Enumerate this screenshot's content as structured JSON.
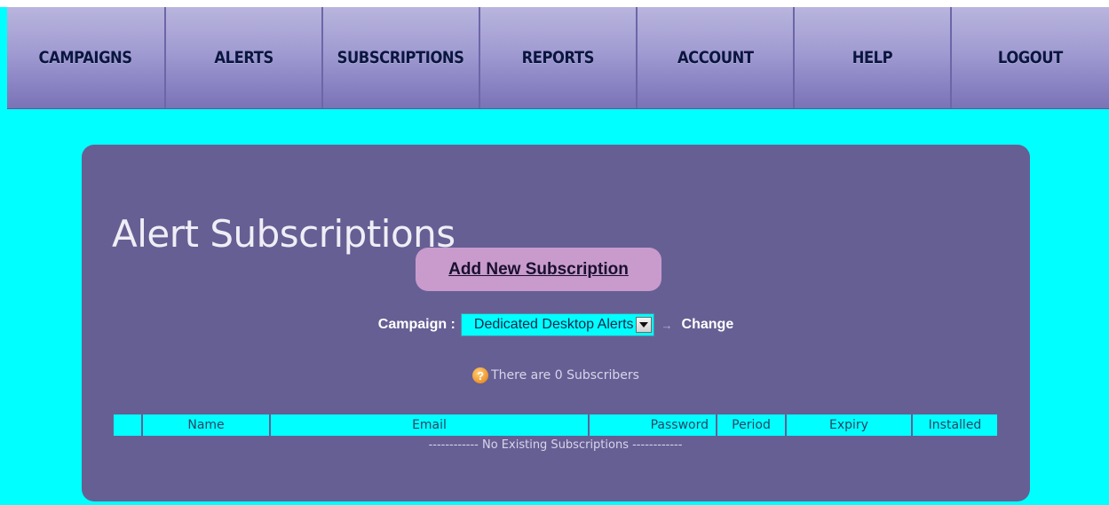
{
  "nav": {
    "items": [
      {
        "label": "CAMPAIGNS"
      },
      {
        "label": "ALERTS"
      },
      {
        "label": "SUBSCRIPTIONS"
      },
      {
        "label": "REPORTS"
      },
      {
        "label": "ACCOUNT"
      },
      {
        "label": "HELP"
      },
      {
        "label": "LOGOUT"
      }
    ]
  },
  "main": {
    "title": "Alert Subscriptions",
    "add_button_label": "Add New Subscription",
    "campaign": {
      "label": "Campaign :",
      "selected_value": "Dedicated Desktop Alerts",
      "arrow": "→",
      "change_label": "Change"
    },
    "info": {
      "icon": "question-icon",
      "icon_glyph": "?",
      "text": "There are 0 Subscribers"
    },
    "table": {
      "columns": [
        "",
        "Name",
        "Email",
        "Password",
        "Period",
        "Expiry",
        "Installed"
      ],
      "empty_message": "------------ No Existing Subscriptions ------------"
    }
  },
  "colors": {
    "page_background": "#00ffff",
    "panel_background": "#665f94",
    "nav_text": "#0a1640",
    "add_button_background": "#c89bcc",
    "table_header_background": "#00ffff"
  }
}
